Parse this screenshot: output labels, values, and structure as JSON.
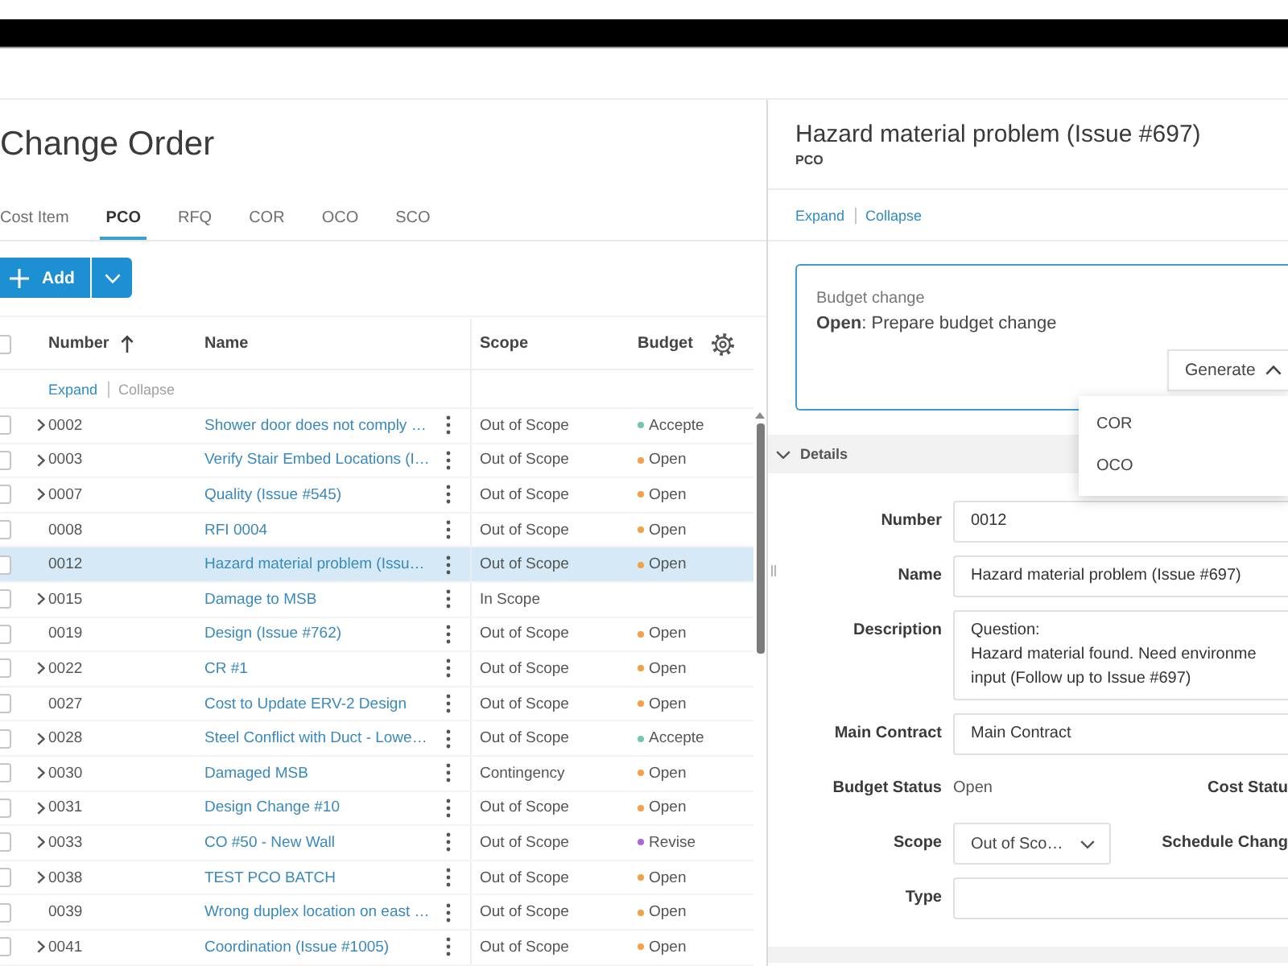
{
  "page": {
    "title": "Change Order"
  },
  "tabs": [
    {
      "label": "Cost Item",
      "selected": false
    },
    {
      "label": "PCO",
      "selected": true
    },
    {
      "label": "RFQ",
      "selected": false
    },
    {
      "label": "COR",
      "selected": false
    },
    {
      "label": "OCO",
      "selected": false
    },
    {
      "label": "SCO",
      "selected": false
    }
  ],
  "toolbar": {
    "add_button": "Add"
  },
  "table": {
    "select_all": {
      "checked": false
    },
    "columns": [
      {
        "label": "Number",
        "sorted_ascending": true
      },
      {
        "label": "Name",
        "sorted_ascending": false
      },
      {
        "label": "Scope",
        "sorted_ascending": false
      },
      {
        "label": "Budget",
        "sorted_ascending": false
      }
    ],
    "tree_links": [
      {
        "label": "Expand",
        "disabled": false
      },
      {
        "label": "Collapse",
        "disabled": true
      }
    ],
    "rows": [
      {
        "number": "0002",
        "has_children": true,
        "name": "Shower door does not comply …",
        "scope": "Out of Scope",
        "budget": {
          "text": "Accepte",
          "color": "#72c7a8"
        },
        "checked": false,
        "selected": false
      },
      {
        "number": "0003",
        "has_children": true,
        "name": "Verify Stair Embed Locations (I…",
        "scope": "Out of Scope",
        "budget": {
          "text": "Open",
          "color": "#f4a146"
        },
        "checked": false,
        "selected": false
      },
      {
        "number": "0007",
        "has_children": true,
        "name": "Quality (Issue #545)",
        "scope": "Out of Scope",
        "budget": {
          "text": "Open",
          "color": "#f4a146"
        },
        "checked": false,
        "selected": false
      },
      {
        "number": "0008",
        "has_children": false,
        "name": "RFI 0004",
        "scope": "Out of Scope",
        "budget": {
          "text": "Open",
          "color": "#f4a146"
        },
        "checked": false,
        "selected": false
      },
      {
        "number": "0012",
        "has_children": false,
        "name": "Hazard material problem (Issu…",
        "scope": "Out of Scope",
        "budget": {
          "text": "Open",
          "color": "#f4a146"
        },
        "checked": false,
        "selected": true
      },
      {
        "number": "0015",
        "has_children": true,
        "name": "Damage to MSB",
        "scope": "In Scope",
        "checked": false,
        "selected": false
      },
      {
        "number": "0019",
        "has_children": false,
        "name": "Design (Issue #762)",
        "scope": "Out of Scope",
        "budget": {
          "text": "Open",
          "color": "#f4a146"
        },
        "checked": false,
        "selected": false
      },
      {
        "number": "0022",
        "has_children": true,
        "name": "CR #1",
        "scope": "Out of Scope",
        "budget": {
          "text": "Open",
          "color": "#f4a146"
        },
        "checked": false,
        "selected": false
      },
      {
        "number": "0027",
        "has_children": false,
        "name": "Cost to Update ERV-2 Design",
        "scope": "Out of Scope",
        "budget": {
          "text": "Open",
          "color": "#f4a146"
        },
        "checked": false,
        "selected": false
      },
      {
        "number": "0028",
        "has_children": true,
        "name": "Steel Conflict with Duct - Lowe…",
        "scope": "Out of Scope",
        "budget": {
          "text": "Accepte",
          "color": "#72c7a8"
        },
        "checked": false,
        "selected": false
      },
      {
        "number": "0030",
        "has_children": true,
        "name": "Damaged MSB",
        "scope": "Contingency",
        "budget": {
          "text": "Open",
          "color": "#f4a146"
        },
        "checked": false,
        "selected": false
      },
      {
        "number": "0031",
        "has_children": true,
        "name": "Design Change #10",
        "scope": "Out of Scope",
        "budget": {
          "text": "Open",
          "color": "#f4a146"
        },
        "checked": false,
        "selected": false
      },
      {
        "number": "0033",
        "has_children": true,
        "name": "CO #50 - New Wall",
        "scope": "Out of Scope",
        "budget": {
          "text": "Revise",
          "color": "#a866d9"
        },
        "checked": false,
        "selected": false
      },
      {
        "number": "0038",
        "has_children": true,
        "name": "TEST PCO BATCH",
        "scope": "Out of Scope",
        "budget": {
          "text": "Open",
          "color": "#f4a146"
        },
        "checked": false,
        "selected": false
      },
      {
        "number": "0039",
        "has_children": false,
        "name": "Wrong duplex location on east …",
        "scope": "Out of Scope",
        "budget": {
          "text": "Open",
          "color": "#f4a146"
        },
        "checked": false,
        "selected": false
      },
      {
        "number": "0041",
        "has_children": true,
        "name": "Coordination (Issue #1005)",
        "scope": "Out of Scope",
        "budget": {
          "text": "Open",
          "color": "#f4a146"
        },
        "checked": false,
        "selected": false
      }
    ]
  },
  "detail_panel": {
    "title": "Hazard material problem (Issue #697)",
    "subtitle": "PCO",
    "tree_links": [
      {
        "label": "Expand",
        "disabled": false
      },
      {
        "label": "Collapse",
        "disabled": false
      }
    ],
    "workflow_card": {
      "label": "Budget change",
      "status": "**Open**: Prepare budget change",
      "button": "Generate",
      "menu_open": true,
      "menu": [
        "COR",
        "OCO"
      ]
    },
    "sections": [
      {
        "title": "Details",
        "expanded": true
      }
    ],
    "fields": [
      {
        "label": "Number",
        "kind": "input",
        "value": "0012"
      },
      {
        "label": "Name",
        "kind": "input",
        "value": "Hazard material problem (Issue #697)"
      },
      {
        "label": "Description",
        "kind": "textarea",
        "value": "Question:\nHazard material found. Need environme\ninput (Follow up to Issue #697)"
      },
      {
        "label": "Main Contract",
        "kind": "input",
        "value": "Main Contract"
      },
      {
        "label": "Budget Status",
        "kind": "text",
        "value": "Open",
        "side_label": "Cost Statu"
      },
      {
        "label": "Scope",
        "kind": "select",
        "value": "Out of Sco…",
        "side_label": "Schedule Chang"
      },
      {
        "label": "Type",
        "kind": "input"
      }
    ]
  }
}
